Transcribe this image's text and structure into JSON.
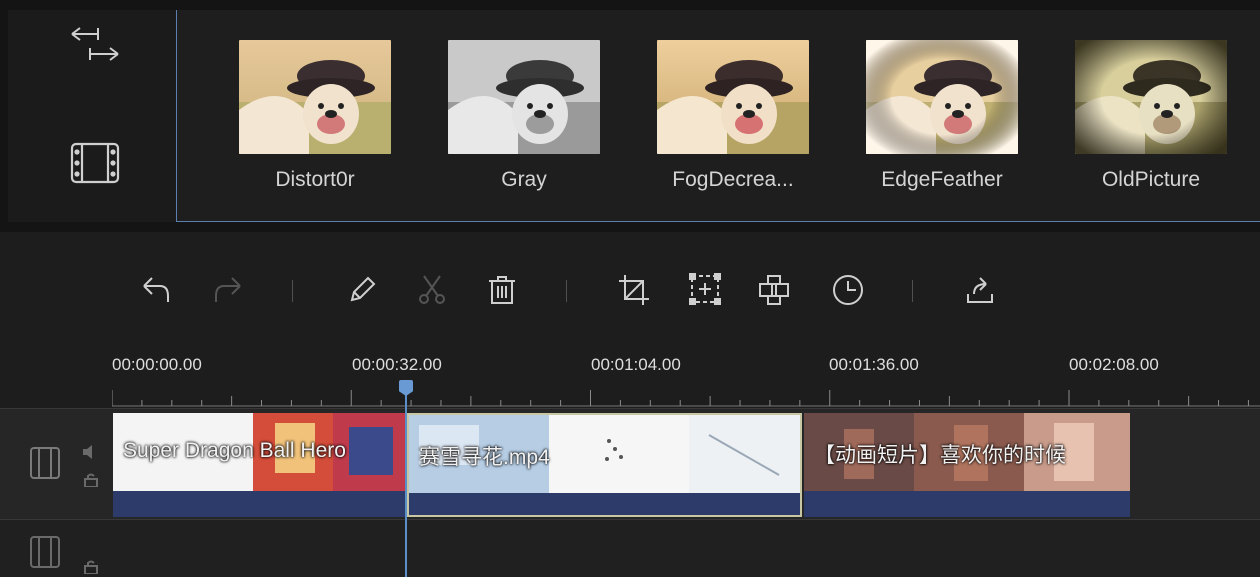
{
  "effects": {
    "items": [
      {
        "label": "Distort0r",
        "tone": "warm"
      },
      {
        "label": "Gray",
        "tone": "gray"
      },
      {
        "label": "FogDecrea...",
        "tone": "warm"
      },
      {
        "label": "EdgeFeather",
        "tone": "feather"
      },
      {
        "label": "OldPicture",
        "tone": "old"
      }
    ]
  },
  "left_rail": {
    "icons": [
      "swap-arrows-icon",
      "film-frame-icon"
    ]
  },
  "toolbar": {
    "tools": [
      "undo-icon",
      "redo-icon",
      "edit-icon",
      "cut-icon",
      "delete-icon",
      "crop-icon",
      "zoom-fit-icon",
      "mosaic-icon",
      "speed-icon",
      "export-icon"
    ]
  },
  "timeline": {
    "timestamps": [
      "00:00:00.00",
      "00:00:32.00",
      "00:01:04.00",
      "00:01:36.00",
      "00:02:08.00"
    ],
    "clips": [
      {
        "title": "Super Dragon Ball Hero",
        "selected": false
      },
      {
        "title": "赛雪寻花.mp4",
        "selected": true
      },
      {
        "title": "【动画短片】喜欢你的时候",
        "selected": false
      }
    ],
    "playhead_time_seconds": 32
  },
  "colors": {
    "accent": "#5b8fc7",
    "audio": "#2c3b6a",
    "selected_border": "#c7c7a3"
  }
}
